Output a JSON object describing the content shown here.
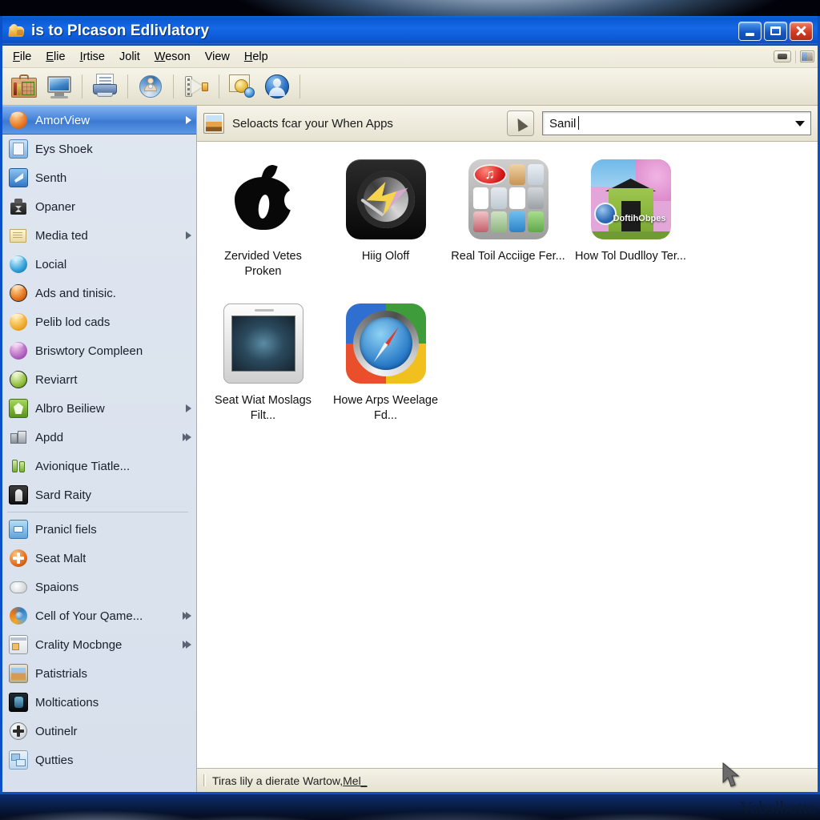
{
  "window": {
    "title": "is to Plcason Edlivlatory",
    "title_icon": "folder-gold-icon",
    "buttons": {
      "minimize": "minimize",
      "maximize": "maximize",
      "close": "close"
    }
  },
  "menubar": {
    "items": [
      {
        "label": "File",
        "mnemonic": "F"
      },
      {
        "label": "Elie",
        "mnemonic": "E"
      },
      {
        "label": "Irtise",
        "mnemonic": "I"
      },
      {
        "label": "Jolit",
        "mnemonic": ""
      },
      {
        "label": "Weson",
        "mnemonic": "W"
      },
      {
        "label": "View",
        "mnemonic": ""
      },
      {
        "label": "Help",
        "mnemonic": "H"
      }
    ],
    "right_buttons": [
      "display-toggle-icon",
      "split-view-icon"
    ]
  },
  "toolbar": {
    "buttons": [
      {
        "name": "library-case-icon"
      },
      {
        "name": "monitor-icon"
      },
      {
        "name": "printer-icon"
      },
      {
        "name": "disc-user-icon"
      },
      {
        "name": "film-export-icon"
      },
      {
        "name": "frame-web-icon"
      },
      {
        "name": "user-account-icon"
      }
    ]
  },
  "sidebar": {
    "items": [
      {
        "label": "AmorView",
        "icon": "people-orange-icon",
        "selected": true,
        "arrow": "single"
      },
      {
        "label": "Eys Shoek",
        "icon": "book-blue-icon",
        "selected": false,
        "arrow": "none"
      },
      {
        "label": "Senth",
        "icon": "pen-blue-icon",
        "selected": false,
        "arrow": "none"
      },
      {
        "label": "Opaner",
        "icon": "scanner-gray-icon",
        "selected": false,
        "arrow": "none"
      },
      {
        "label": "Media ted",
        "icon": "folder-cream-icon",
        "selected": false,
        "arrow": "single"
      },
      {
        "label": "Locial",
        "icon": "globe-cyan-icon",
        "selected": false,
        "arrow": "none"
      },
      {
        "label": "Ads and tinisic.",
        "icon": "orb-orange-icon",
        "selected": false,
        "arrow": "none"
      },
      {
        "label": "Pelib lod cads",
        "icon": "balloon-yellow-icon",
        "selected": false,
        "arrow": "none"
      },
      {
        "label": "Briswtory Compleen",
        "icon": "orb-purple-icon",
        "selected": false,
        "arrow": "none"
      },
      {
        "label": "Reviarrt",
        "icon": "orb-green-icon",
        "selected": false,
        "arrow": "none"
      },
      {
        "label": "Albro Beiliew",
        "icon": "ribbon-green-icon",
        "selected": false,
        "arrow": "single"
      },
      {
        "label": "Apdd",
        "icon": "coins-gray-icon",
        "selected": false,
        "arrow": "double"
      },
      {
        "label": "Avionique Tiatle...",
        "icon": "bottles-green-icon",
        "selected": false,
        "arrow": "none"
      },
      {
        "label": "Sard Raity",
        "icon": "tombstone-dark-icon",
        "selected": false,
        "arrow": "none"
      },
      {
        "divider": true
      },
      {
        "label": "Pranicl fiels",
        "icon": "printer-blue-icon",
        "selected": false,
        "arrow": "none"
      },
      {
        "label": "Seat Malt",
        "icon": "plus-orange-icon",
        "selected": false,
        "arrow": "none"
      },
      {
        "label": "Spaions",
        "icon": "cloud-gray-icon",
        "selected": false,
        "arrow": "none"
      },
      {
        "label": "Cell of Your Qame...",
        "icon": "firefox-icon",
        "selected": false,
        "arrow": "double"
      },
      {
        "label": "Crality Mocbnge",
        "icon": "window-note-icon",
        "selected": false,
        "arrow": "double"
      },
      {
        "label": "Patistrials",
        "icon": "photo-frame-icon",
        "selected": false,
        "arrow": "none"
      },
      {
        "label": "Moltications",
        "icon": "dark-app-icon",
        "selected": false,
        "arrow": "none"
      },
      {
        "label": "Outinelr",
        "icon": "plus-circle-icon",
        "selected": false,
        "arrow": "none"
      },
      {
        "label": "Qutties",
        "icon": "windows-blue-icon",
        "selected": false,
        "arrow": "none"
      }
    ]
  },
  "content": {
    "header": {
      "thumb_icon": "library-thumb-icon",
      "title": "Seloacts fcar your When Apps",
      "glyph_button": "feather-pointer-icon"
    },
    "search": {
      "value": "Sanil",
      "dropdown_icon": "chevron-down-icon"
    },
    "apps": [
      {
        "label": "Zervided Vetes Proken",
        "art": "apple"
      },
      {
        "label": "Hiig Oloff",
        "art": "quicktime"
      },
      {
        "label": "Real Toil Acciige Fer...",
        "art": "folder-tiles"
      },
      {
        "label": "How Tol Dudlloy Ter...",
        "art": "house",
        "watermark": "DoftihObpes"
      },
      {
        "label": "Seat Wiat Moslags Filt...",
        "art": "tablet"
      },
      {
        "label": "Howe Arps Weelage Fd...",
        "art": "safari"
      }
    ]
  },
  "statusbar": {
    "text": "Tiras lily a dierate Wartow, ",
    "link": "Mel_"
  },
  "watermark": "Vabslbotto",
  "colors": {
    "titlebar_blue": "#0a58d0",
    "window_border": "#0a51c8",
    "sidebar_bg": "#dfe6f0",
    "selection_blue": "#4a86da",
    "chrome_beige": "#ece9d8",
    "close_red": "#d33b23"
  }
}
